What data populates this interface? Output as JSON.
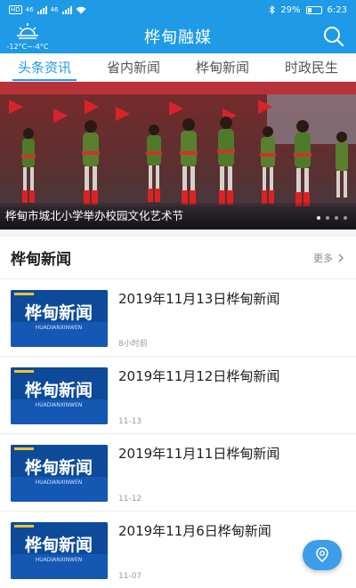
{
  "status_bar": {
    "left_labels": [
      "HD",
      "46",
      "46"
    ],
    "battery": "29%",
    "time": "6:23"
  },
  "header": {
    "title": "桦甸融媒",
    "weather_temp": "-12°C~-4°C",
    "weather_icon": "sun-icon",
    "search_icon": "search-icon"
  },
  "tabs": [
    {
      "label": "头条资讯",
      "active": true
    },
    {
      "label": "省内新闻",
      "active": false
    },
    {
      "label": "桦甸新闻",
      "active": false
    },
    {
      "label": "时政民生",
      "active": false
    }
  ],
  "banner": {
    "caption": "桦甸市城北小学举办校园文化艺术节",
    "slide_count": 4,
    "active_slide": 1
  },
  "section": {
    "title": "桦甸新闻",
    "more_label": "更多"
  },
  "news": [
    {
      "title": "2019年11月13日桦甸新闻",
      "time": "8小时前",
      "thumb_label": "桦甸新闻",
      "thumb_sub": "HUADIANXINWEN"
    },
    {
      "title": "2019年11月12日桦甸新闻",
      "time": "11-13",
      "thumb_label": "桦甸新闻",
      "thumb_sub": "HUADIANXINWEN"
    },
    {
      "title": "2019年11月11日桦甸新闻",
      "time": "11-12",
      "thumb_label": "桦甸新闻",
      "thumb_sub": "HUADIANXINWEN"
    },
    {
      "title": "2019年11月6日桦甸新闻",
      "time": "11-07",
      "thumb_label": "桦甸新闻",
      "thumb_sub": "HUADIANXINWEN"
    }
  ],
  "colors": {
    "brand": "#1e9ae6",
    "fab": "#3d9de8"
  },
  "fab_icon": "location-pin-icon"
}
